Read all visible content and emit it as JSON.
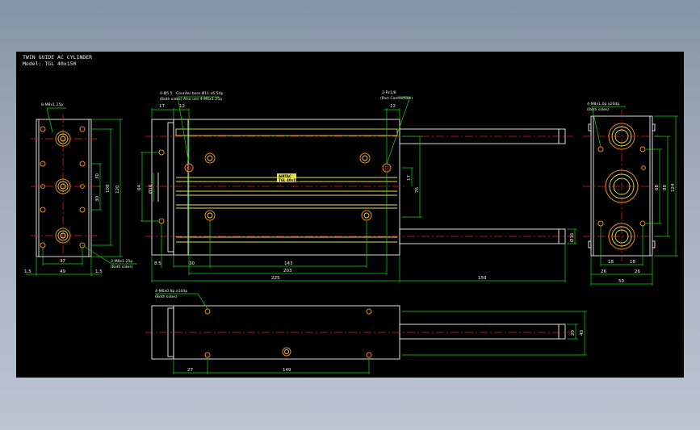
{
  "title_block": {
    "line1": "TWIN GUIDE AC CYLINDER",
    "line2": "Model: TGL 40x150"
  },
  "notes": {
    "left_view_top": "8-M8x1.25p",
    "left_view_bottom": "3-M8x1.25p",
    "left_view_bottom_sub": "(Both sides)",
    "front_top_left": "4-Ø5.5",
    "front_top_left_sub": "Counter bore Ø11 x6.5dp",
    "front_top_left_sub2": "(Both sides) Also use 4-M6x1.25p",
    "front_top_right": "2-Rc1/8",
    "front_top_right_sub": "(Port Connection)",
    "right_view_top": "4-M8x1.0p x20dp",
    "right_view_top_sub": "(Both sides)",
    "bottom_view": "4-M6x0.8p x10dp",
    "bottom_view_sub": "(Both sides)"
  },
  "nameplate": {
    "line1": "AIRTAC",
    "line2": "TGL 40x150"
  },
  "dimensions": {
    "left_width": "37",
    "left_total": "49",
    "left_side_a": "1.5",
    "left_side_b": "1.5",
    "left_h1": "30",
    "left_h2": "30",
    "left_h3": "108",
    "left_h4": "120",
    "front_17": "17",
    "front_12a": "12",
    "front_12b": "12",
    "front_64": "64",
    "front_phi": "Ø16",
    "front_17b": "17",
    "front_76": "76",
    "front_8_5": "8.5",
    "front_30": "30",
    "front_143": "143",
    "front_203": "203",
    "front_225": "225",
    "front_150": "150",
    "front_rod": "Ø16",
    "right_68": "68",
    "right_88": "88",
    "right_124": "124",
    "right_18a": "18",
    "right_18b": "18",
    "right_26a": "26",
    "right_26b": "26",
    "right_50": "50",
    "bottom_20": "20",
    "bottom_40": "40",
    "bottom_27": "27",
    "bottom_149": "149"
  }
}
